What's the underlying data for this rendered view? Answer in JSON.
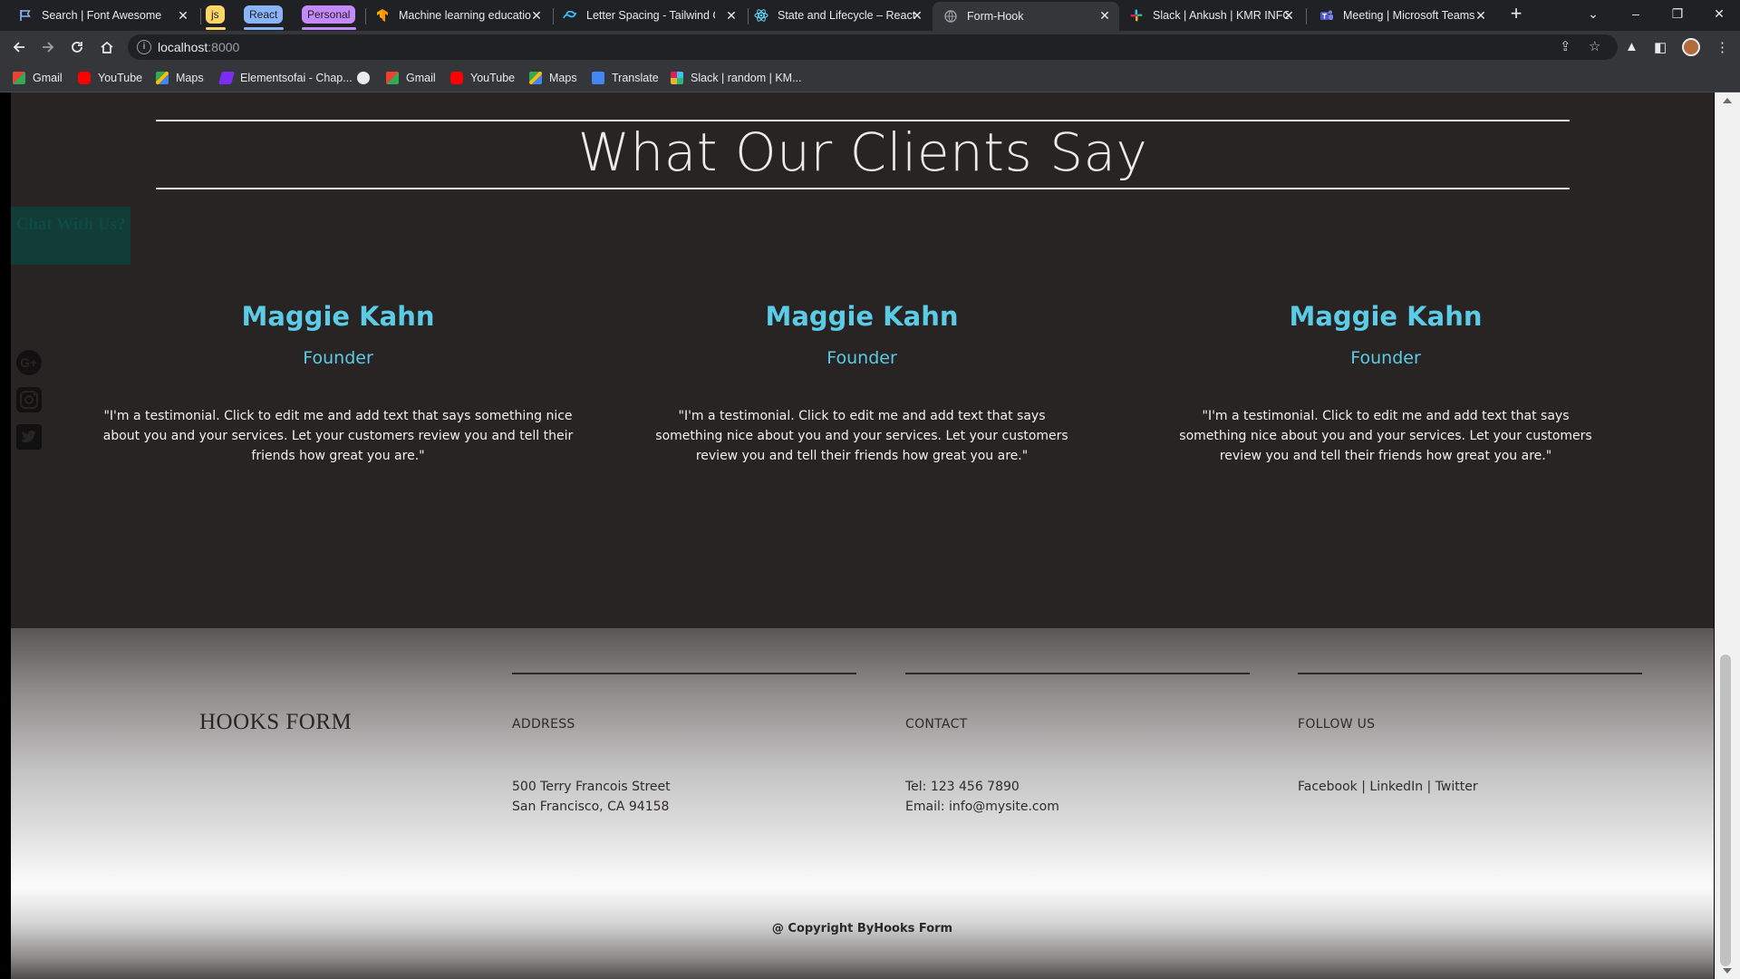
{
  "browser": {
    "tabs": [
      {
        "title": "Search | Font Awesome",
        "icon": "flag-icon"
      },
      {
        "title": "Machine learning educatio",
        "icon": "tensorflow-icon"
      },
      {
        "title": "Letter Spacing - Tailwind C",
        "icon": "tailwind-icon"
      },
      {
        "title": "State and Lifecycle – React",
        "icon": "react-icon"
      },
      {
        "title": "Form-Hook",
        "icon": "globe-icon"
      },
      {
        "title": "Slack | Ankush | KMR INFO",
        "icon": "slack-icon"
      },
      {
        "title": "Meeting | Microsoft Teams",
        "icon": "teams-icon"
      }
    ],
    "groups": [
      {
        "label": "js",
        "color": "#fdd663"
      },
      {
        "label": "React",
        "color": "#8ab4f8"
      },
      {
        "label": "Personal",
        "color": "#c58af9"
      }
    ],
    "url_host": "localhost",
    "url_port": ":8000",
    "bookmarks": [
      "Gmail",
      "YouTube",
      "Maps",
      "Elementsofai - Chap...",
      "Gmail",
      "YouTube",
      "Maps",
      "Translate",
      "Slack | random | KM..."
    ]
  },
  "chat_widget": {
    "label": "Chat With Us?"
  },
  "social_rail": [
    "google-plus-icon",
    "instagram-icon",
    "twitter-icon"
  ],
  "section": {
    "title": "What Our Clients Say"
  },
  "testimonials": [
    {
      "name": "Maggie Kahn",
      "role": "Founder",
      "quote": "\"I'm a testimonial. Click to edit me and add text that says something nice about you and your services. Let your customers review you and tell their friends how great you are.\""
    },
    {
      "name": "Maggie Kahn",
      "role": "Founder",
      "quote": "\"I'm a testimonial. Click to edit me and add text that says something nice about you and your services. Let your customers review you and tell their friends how great you are.\""
    },
    {
      "name": "Maggie Kahn",
      "role": "Founder",
      "quote": "\"I'm a testimonial. Click to edit me and add text that says something nice about you and your services. Let your customers review you and tell their friends how great you are.\""
    }
  ],
  "footer": {
    "logo": "HOOKS FORM",
    "address": {
      "heading": "ADDRESS",
      "line1": "500 Terry Francois Street",
      "line2": "San Francisco, CA 94158"
    },
    "contact": {
      "heading": "CONTACT",
      "line1": "Tel: 123 456 7890",
      "line2": "Email: info@mysite.com"
    },
    "follow": {
      "heading": "FOLLOW US",
      "line1": "Facebook | LinkedIn | Twitter"
    },
    "copyright": "@ Copyright ByHooks Form"
  },
  "colors": {
    "accent": "#5bcbe6",
    "page_bg": "#282423",
    "chat_bg": "#123c38"
  }
}
